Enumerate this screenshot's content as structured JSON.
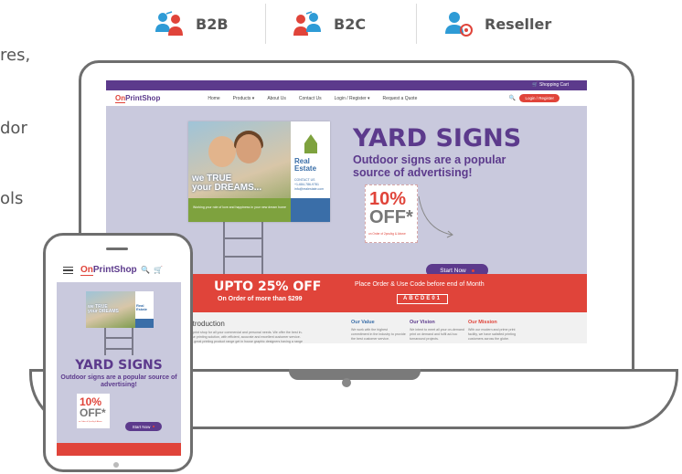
{
  "segments": [
    {
      "label": "B2B",
      "icon": "b2b-users-icon"
    },
    {
      "label": "B2C",
      "icon": "b2c-users-icon"
    },
    {
      "label": "Reseller",
      "icon": "reseller-user-icon"
    }
  ],
  "left_fragments": [
    "res,",
    "dor",
    "ols"
  ],
  "laptop": {
    "cart_label": "Shopping Cart",
    "logo_on": "On",
    "logo_rest": "PrintShop",
    "nav": [
      "Home",
      "Products ▾",
      "About Us",
      "Contact Us",
      "Login / Register ▾",
      "Request a Quote"
    ],
    "login_btn": "Login / Register",
    "sign": {
      "tagline1": "we TRUE",
      "tagline2": "your DREAMS...",
      "green_text": "Working your role of love and happiness in your new dream home",
      "brand_real": "Real",
      "brand_estate": "Estate",
      "contact": "CONTACT US",
      "phone": "+1-684-786-9781",
      "email": "info@realestate.com"
    },
    "hero_title": "YARD SIGNS",
    "hero_sub": "Outdoor signs are a popular source of advertising!",
    "offer_pct": "10%",
    "offer_off": "OFF*",
    "offer_note": "on Order of 2pcs/kg & Above",
    "start_btn": "Start Now",
    "tc": "T & C Apply",
    "promo_title": "UPTO 25% OFF",
    "promo_sub": "On Order of more than $299",
    "place_order": "Place Order & Use Code before end of Month",
    "code": "ABCDE01",
    "intro_title": "Introduction",
    "intro_text": "Our print shop for all your commercial and personal needs. We offer the best in-house printing solution, with efficient, accurate and excellent customer service. With great printing product range get in house graphic designers having a range of skills and styles... Know More",
    "columns": [
      {
        "title": "Our Value",
        "color": "#3a6ea8",
        "text": "We work with the highest commitment in the industry to provide the best customer service."
      },
      {
        "title": "Our Vision",
        "color": "#5c3a8c",
        "text": "We intent to meet all your on-demand print on demand and fulfil ad-hoc turnaround projects."
      },
      {
        "title": "Our Mission",
        "color": "#e0443a",
        "text": "With our modern and prime print facility, we have satisfied printing customers across the globe."
      }
    ]
  },
  "phone": {
    "logo_on": "On",
    "logo_rest": "PrintShop",
    "sign_tag1": "we TRUE",
    "sign_tag2": "your DREAMS",
    "sign_real": "Real",
    "sign_estate": "Estate",
    "hero_title": "YARD SIGNS",
    "hero_sub": "Outdoor signs are a popular source of advertising!",
    "offer_pct": "10%",
    "offer_off": "OFF*",
    "offer_note": "on Order of 2pcs/kg & Above",
    "start_btn": "Start Now"
  },
  "colors": {
    "purple": "#5c3a8c",
    "red": "#e0443a",
    "blue": "#3a6ea8",
    "green": "#7ea23e",
    "hero_bg": "#c9c9dd"
  }
}
